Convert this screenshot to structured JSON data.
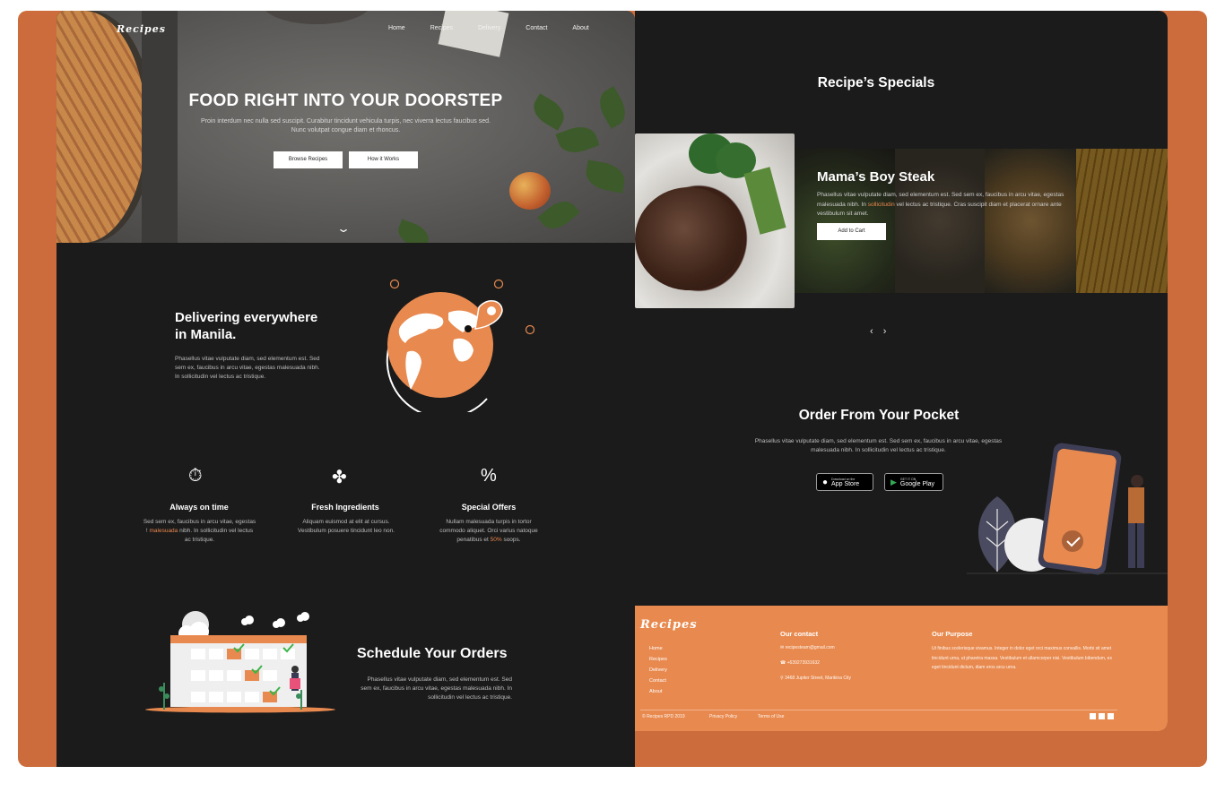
{
  "hero": {
    "logo": "Recipes",
    "nav": [
      "Home",
      "Recipes",
      "Delivery",
      "Contact",
      "About"
    ],
    "title": "FOOD RIGHT INTO YOUR DOORSTEP",
    "subtitle": "Proin interdum nec nulla sed suscipit. Curabitur tincidunt vehicula turpis, nec viverra lectus faucibus sed. Nunc volutpat congue diam et rhoncus.",
    "primary_button": "Browse Recipes",
    "secondary_button": "How it Works"
  },
  "delivery": {
    "title_line1": "Delivering everywhere",
    "title_line2": "in Manila.",
    "text": "Phasellus vitae vulputate diam, sed elementum est. Sed sem ex, faucibus in arcu vitae, egestas malesuada nibh. In sollicitudin vel lectus ac tristique."
  },
  "features": [
    {
      "title": "Always on time",
      "text_a": "Sed sem ex, faucibus in arcu vitae, egestas ! ",
      "highlight": "malesuada",
      "text_b": " nibh. In sollicitudin vel lectus ac tristique."
    },
    {
      "title": "Fresh Ingredients",
      "text_a": "Aliquam euismod at elit at cursus. Vestibulum posuere tincidunt leo non.",
      "highlight": "",
      "text_b": ""
    },
    {
      "title": "Special Offers",
      "text_a": "Nullam malesuada turpis in tortor commodo aliquet. Orci varius natoque penatibus et ",
      "highlight": "50%",
      "text_b": " soops."
    }
  ],
  "schedule": {
    "title": "Schedule Your Orders",
    "text": "Phasellus vitae vulputate diam, sed elementum est. Sed sem ex, faucibus in arcu vitae, egestas malesuada nibh. In sollicitudin vel lectus ac tristique."
  },
  "specials": {
    "title": "Recipe’s Specials",
    "item_title": "Mama’s Boy Steak",
    "text_a": "Phasellus vitae vulputate diam, sed elementum est. Sed sem ex, faucibus in arcu vitae, egestas malesuada nibh. In ",
    "highlight": "sollicitudin",
    "text_b": " vel lectus ac tristique. Cras suscipit diam et placerat ornare ante vestibulum sit amet.",
    "button": "Add to Cart",
    "arrows": "‹ ›"
  },
  "pocket": {
    "title": "Order From Your Pocket",
    "text": "Phasellus vitae vulputate diam, sed elementum est. Sed sem ex, faucibus in arcu vitae, egestas malesuada nibh. In sollicitudin vel lectus ac tristique.",
    "appstore_small": "Download on the",
    "appstore": "App Store",
    "googleplay_small": "GET IT ON",
    "googleplay": "Google Play"
  },
  "footer": {
    "logo": "Recipes",
    "links": [
      "Home",
      "Recipes",
      "Delivery",
      "Contact",
      "About"
    ],
    "contact_title": "Our contact",
    "email": "recipesteam@gmail.com",
    "phone": "+639273931632",
    "address": "3468 Jupiter Street, Marikina City",
    "purpose_title": "Our Purpose",
    "purpose_text": "Ut finibus scelerisque vivamus. Integer in dolor eget orci maximus convallis. Morbi sit amet tincidunt urna, ut pharetra massa. Vestibulum et ullamcorper nisi. Vestibulum bibendum, ex eget tincidunt dictum, diam eros arcu urna.",
    "copyright": "© Recipes RPD 2019",
    "privacy": "Privacy Policy",
    "terms": "Terms of Use"
  },
  "colors": {
    "accent": "#e88a4f",
    "frame": "#cc6b3c",
    "dark": "#1b1b1b"
  }
}
